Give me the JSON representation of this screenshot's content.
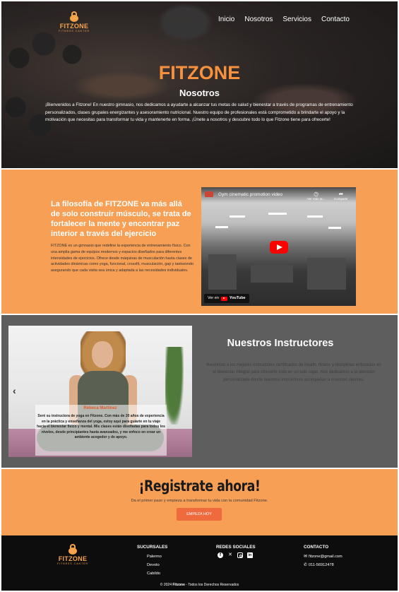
{
  "brand": {
    "name": "FITZONE",
    "tagline": "FITNESS CANTER",
    "accent": "#f7913d",
    "orange_bg": "#f79f55"
  },
  "nav": {
    "items": [
      "Inicio",
      "Nosotros",
      "Servicios",
      "Contacto"
    ]
  },
  "hero": {
    "title": "FITZONE",
    "subtitle": "Nosotros",
    "description": "¡Bienvenidos a Fitzone! En nuestro gimnasio, nos dedicamos a ayudarte a alcanzar tus metas de salud y bienestar a través de programas de entrenamiento personalizados, clases grupales energizantes y asesoramiento nutricional. Nuestro equipo de profesionales está comprometido a brindarte el apoyo y la motivación que necesitas para transformar tu vida y mantenerte en forma. ¡Únete a nosotros y descubre todo lo que Fitzone tiene para ofrecerte!"
  },
  "about": {
    "heading": "La filosofía de FITZONE va más allá de solo construir músculo, se trata de fortalecer la mente y encontrar paz interior a través del ejercicio",
    "text": "FITZONE es un gimnasio que redefine la experiencia de entrenamiento físico. Con una amplia gama de equipos modernos y espacios diseñados para diferentes intensidades de ejercicios. Ofrece desde máquinas de musculación hasta clases de actividades dinámicas como yoga, funcional, crossfit, musculación, gap y taekwondo asegurando que cada visita sea única y adaptada a las necesidades individuales.",
    "video": {
      "title": "Gym cinematic promotion video",
      "watch_later": "Ver más ta...",
      "share": "Compartir",
      "watch_on": "Ver en",
      "platform": "YouTube"
    }
  },
  "instructors": {
    "heading": "Nuestros Instructores",
    "text": "Reunimos a los mejores instructores certificados de health, fitness y disciplinas enfocadas en el bienestar integral para ofrecerte todo en un solo lugar. Nos dedicamos a la atención personalizada donde nuestros instructores acompañan a nuestros clientes.",
    "slide": {
      "name": "Rebeca Martinez",
      "text": "Seré su instructora de yoga en Fitzone. Con más de 20 años de experiencia en la práctica y enseñanza del yoga, estoy aquí para guiarte en tu viaje hacia el bienestar físico y mental. Mis clases están diseñadas para todos los niveles, desde principiantes hasta avanzados, y me enfoco en crear un ambiente acogedor y de apoyo.",
      "prev_arrow": "‹"
    }
  },
  "register": {
    "heading": "¡Registrate ahora!",
    "text": "Da el primer paso y empieza a transformar tu vida con la comunidad Fitzone.",
    "button": "EMPEZA HOY"
  },
  "footer": {
    "sucursales": {
      "title": "SUCURSALES",
      "items": [
        "Palermo",
        "Devoto",
        "Cabildo"
      ]
    },
    "redes": {
      "title": "REDES SOCIALES",
      "icons": [
        "facebook-icon",
        "x-icon",
        "instagram-icon",
        "linkedin-icon"
      ]
    },
    "contacto": {
      "title": "CONTACTO",
      "email": "fitzone@gmail.com",
      "phone": "011-56912478"
    },
    "copyright_prefix": "© 2024",
    "copyright_brand": "Fitzone",
    "copyright_suffix": "- Todos los Derechos Reservados"
  }
}
